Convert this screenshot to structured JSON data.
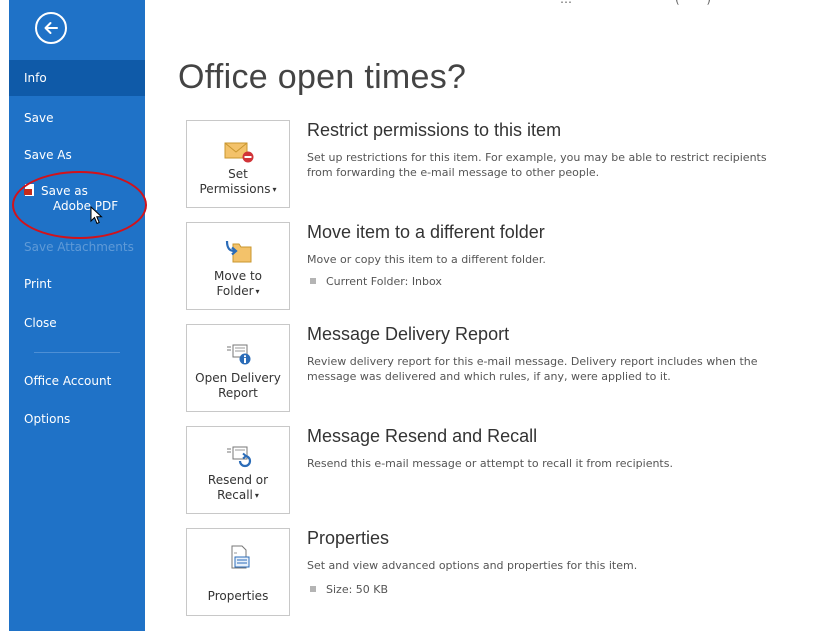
{
  "top_partial_text": "… · · · · · · · · · · · · · ( · · · )",
  "sidebar": {
    "items": [
      {
        "label": "Info"
      },
      {
        "label": "Save"
      },
      {
        "label": "Save As"
      },
      {
        "label": "Save as"
      },
      {
        "label": "Adobe PDF"
      },
      {
        "label": "Save Attachments"
      },
      {
        "label": "Print"
      },
      {
        "label": "Close"
      },
      {
        "label": "Office Account"
      },
      {
        "label": "Options"
      }
    ]
  },
  "page_title": "Office open times?",
  "sections": [
    {
      "button_lines": [
        "Set",
        "Permissions"
      ],
      "title": "Restrict permissions to this item",
      "description": "Set up restrictions for this item. For example, you may be able to restrict recipients from forwarding the e-mail message to other people."
    },
    {
      "button_lines": [
        "Move to",
        "Folder"
      ],
      "title": "Move item to a different folder",
      "description": "Move or copy this item to a different folder.",
      "detail": "Current Folder:  Inbox"
    },
    {
      "button_lines": [
        "Open Delivery",
        "Report"
      ],
      "title": "Message Delivery Report",
      "description": "Review delivery report for this e-mail message. Delivery report includes when the message was delivered and which rules, if any, were applied to it."
    },
    {
      "button_lines": [
        "Resend or",
        "Recall"
      ],
      "title": "Message Resend and Recall",
      "description": "Resend this e-mail message or attempt to recall it from recipients."
    },
    {
      "button_lines": [
        "Properties"
      ],
      "title": "Properties",
      "description": "Set and view advanced options and properties for this item.",
      "detail": "Size:  50 KB"
    }
  ],
  "colors": {
    "sidebar": "#1f72c7",
    "sidebar_active": "#0f5aa8",
    "annotation": "#d2121a"
  }
}
